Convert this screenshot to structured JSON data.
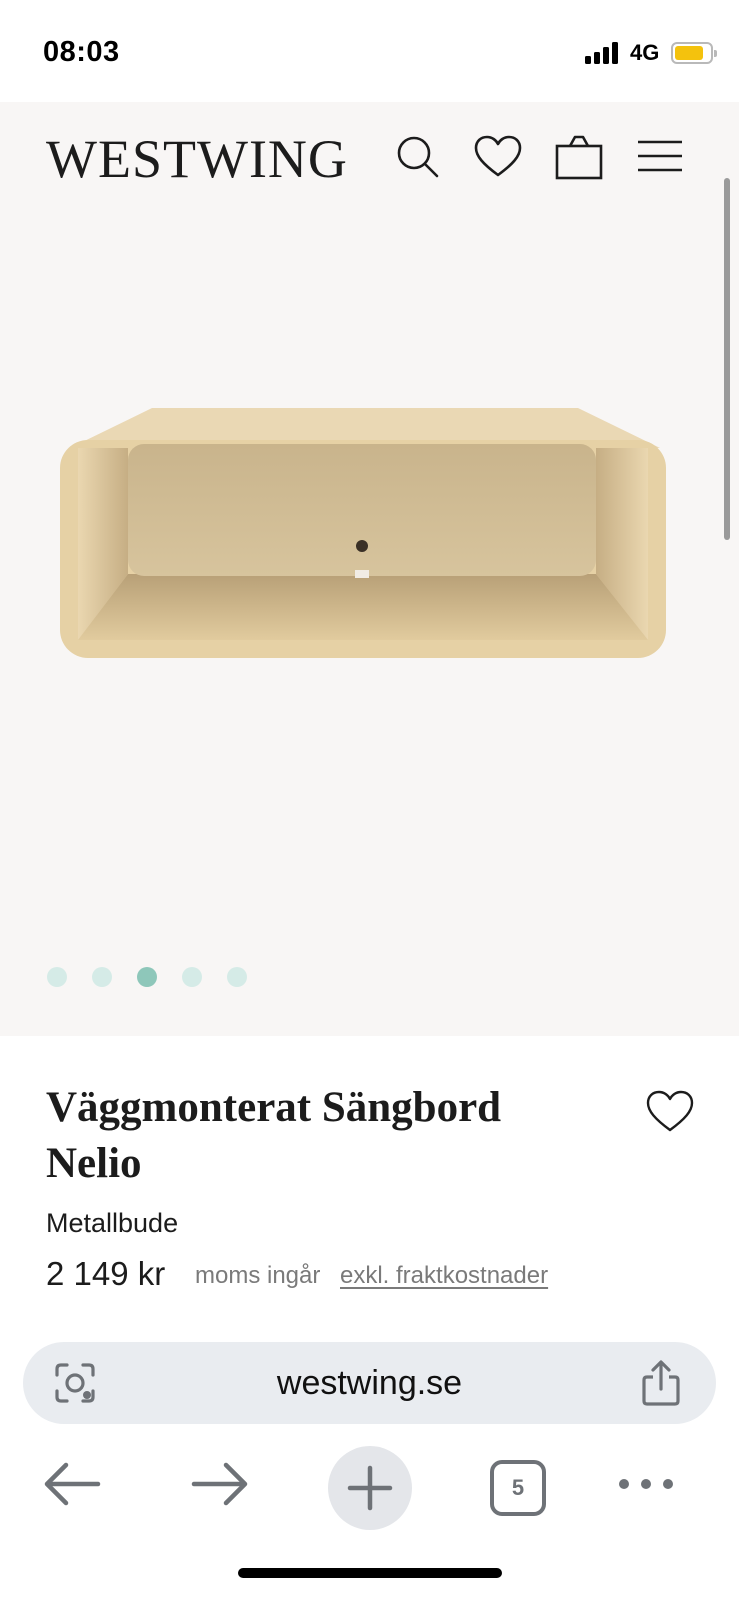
{
  "status_bar": {
    "time": "08:03",
    "network": "4G"
  },
  "header": {
    "logo": "WESTWING",
    "icons": [
      "search-icon",
      "heart-icon",
      "bag-icon",
      "menu-icon"
    ]
  },
  "gallery": {
    "image_count": 5,
    "active_index": 2
  },
  "product": {
    "title": "Väggmonterat Sängbord Nelio",
    "brand": "Metallbude",
    "price": "2 149 kr",
    "vat_note": "moms ingår",
    "shipping_note": "exkl. fraktkostnader"
  },
  "browser": {
    "url": "westwing.se",
    "tab_count": "5"
  },
  "colors": {
    "hero_bg": "#f8f6f5",
    "dot": "#d5ebe7",
    "dot_active": "#8ec7ba",
    "product_tone": "#e3cd9f"
  }
}
